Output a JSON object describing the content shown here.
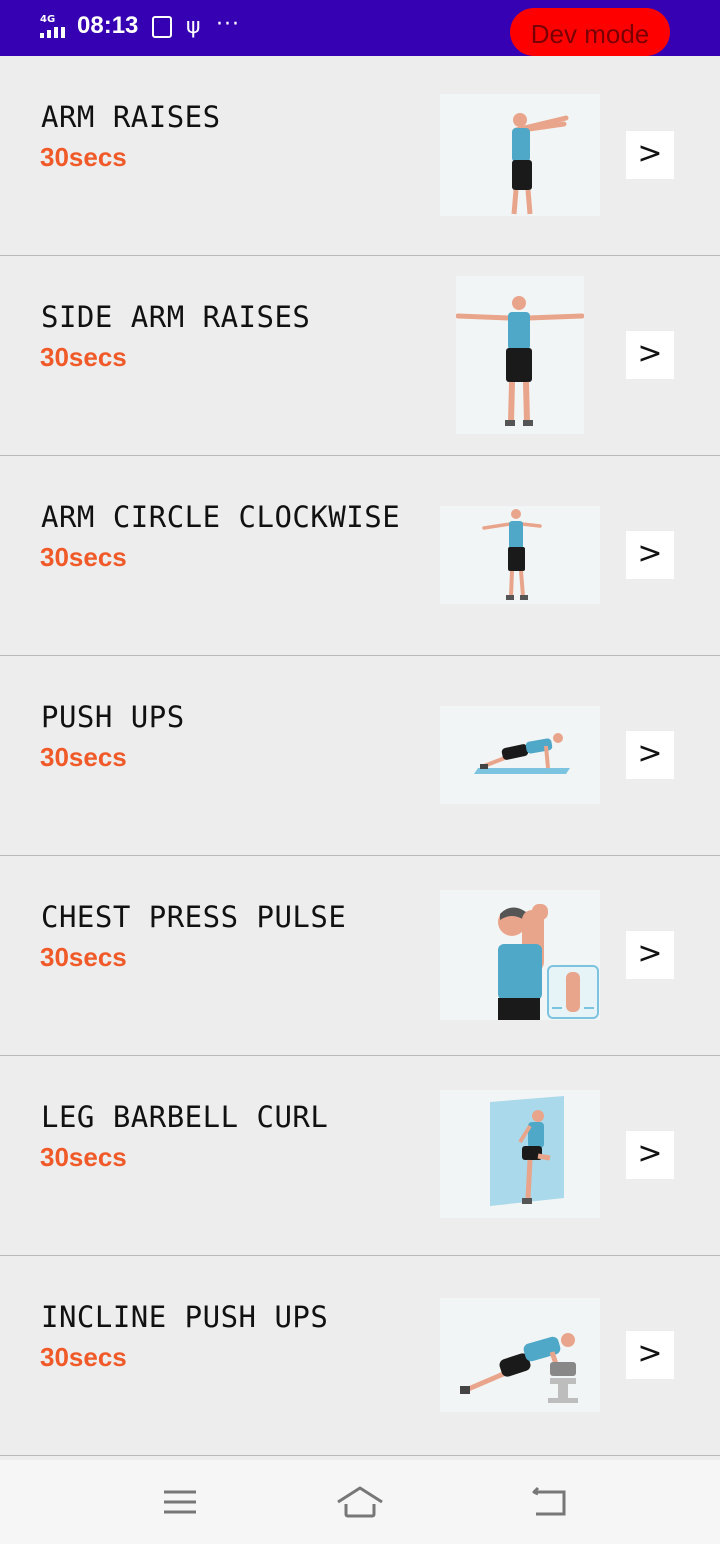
{
  "status_bar": {
    "network": "4G",
    "time": "08:13",
    "usb_box_icon": "usb-debug-icon",
    "usb_icon": "usb-icon",
    "more_icon": "more-dots-icon",
    "dev_mode_label": "Dev mode",
    "background_color": "#3600b3",
    "dev_mode_color": "#ff0000"
  },
  "exercises": [
    {
      "name": "ARM RAISES",
      "duration": "30secs",
      "image": "arm-raises-figure",
      "action": ">"
    },
    {
      "name": "SIDE ARM RAISES",
      "duration": "30secs",
      "image": "side-arm-raises-figure",
      "action": ">"
    },
    {
      "name": "ARM CIRCLE CLOCKWISE",
      "duration": "30secs",
      "image": "arm-circle-figure",
      "action": ">"
    },
    {
      "name": "PUSH UPS",
      "duration": "30secs",
      "image": "push-ups-figure",
      "action": ">"
    },
    {
      "name": "CHEST PRESS PULSE",
      "duration": "30secs",
      "image": "chest-press-figure",
      "action": ">"
    },
    {
      "name": "LEG BARBELL CURL",
      "duration": "30secs",
      "image": "leg-barbell-curl-figure",
      "action": ">"
    },
    {
      "name": "INCLINE PUSH UPS",
      "duration": "30secs",
      "image": "incline-push-ups-figure",
      "action": ">"
    }
  ],
  "accent_color": "#f05a28",
  "nav_bar": {
    "menu_icon": "menu-icon",
    "home_icon": "home-icon",
    "back_icon": "back-icon"
  }
}
